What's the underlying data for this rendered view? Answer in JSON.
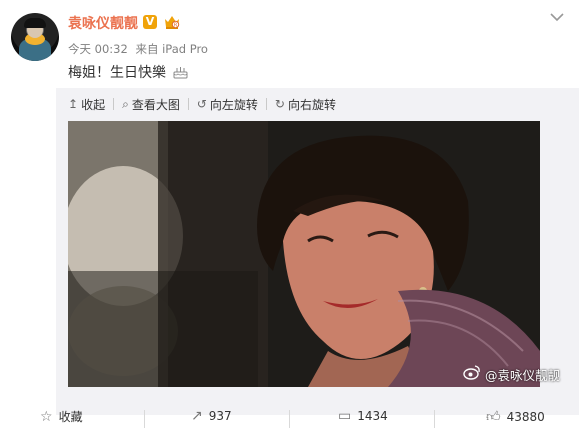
{
  "post": {
    "username": "袁咏仪靓靓",
    "verified_badge": "V",
    "time": "今天 00:32",
    "source": "来自 iPad Pro",
    "text": "梅姐！生日快樂"
  },
  "image_toolbar": {
    "collapse": "收起",
    "view_large": "查看大图",
    "rotate_left": "向左旋转",
    "rotate_right": "向右旋转"
  },
  "photo": {
    "watermark": "@袁咏仪靓靓"
  },
  "actions": {
    "favorite": "收藏",
    "repost_count": "937",
    "comment_count": "1434",
    "like_count": "43880"
  },
  "colors": {
    "username": "#eb7350",
    "badge": "#f0a30a",
    "toolbar_bg": "#f2f2f5"
  }
}
